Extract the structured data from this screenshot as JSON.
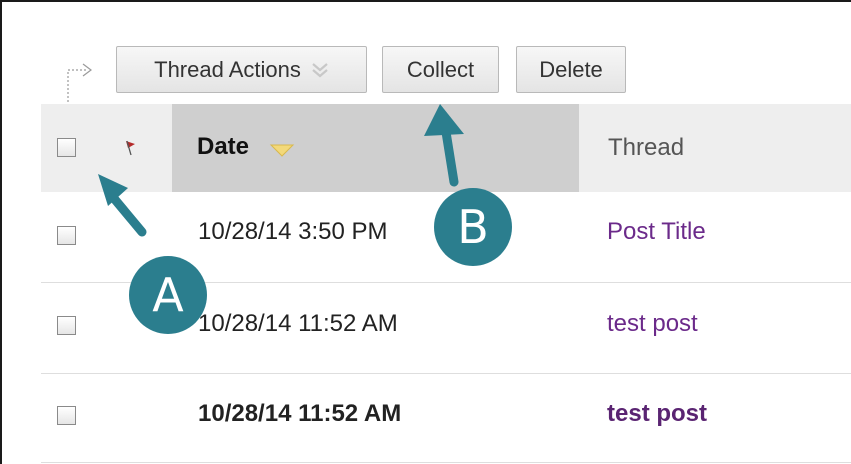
{
  "toolbar": {
    "thread_actions_label": "Thread Actions",
    "collect_label": "Collect",
    "delete_label": "Delete"
  },
  "table": {
    "columns": {
      "date": "Date",
      "thread": "Thread"
    },
    "sort": "descending",
    "rows": [
      {
        "date": "10/28/14 3:50 PM",
        "thread": "Post Title",
        "unread": false
      },
      {
        "date": "10/28/14 11:52 AM",
        "thread": "test post",
        "unread": false
      },
      {
        "date": "10/28/14 11:52 AM",
        "thread": "test post",
        "unread": true
      }
    ]
  },
  "annotations": {
    "a_label": "A",
    "b_label": "B"
  },
  "colors": {
    "callout": "#2b7e8e",
    "link": "#6b2a8a",
    "flag": "#b42a2a",
    "sort_arrow": "#f3d97a"
  }
}
